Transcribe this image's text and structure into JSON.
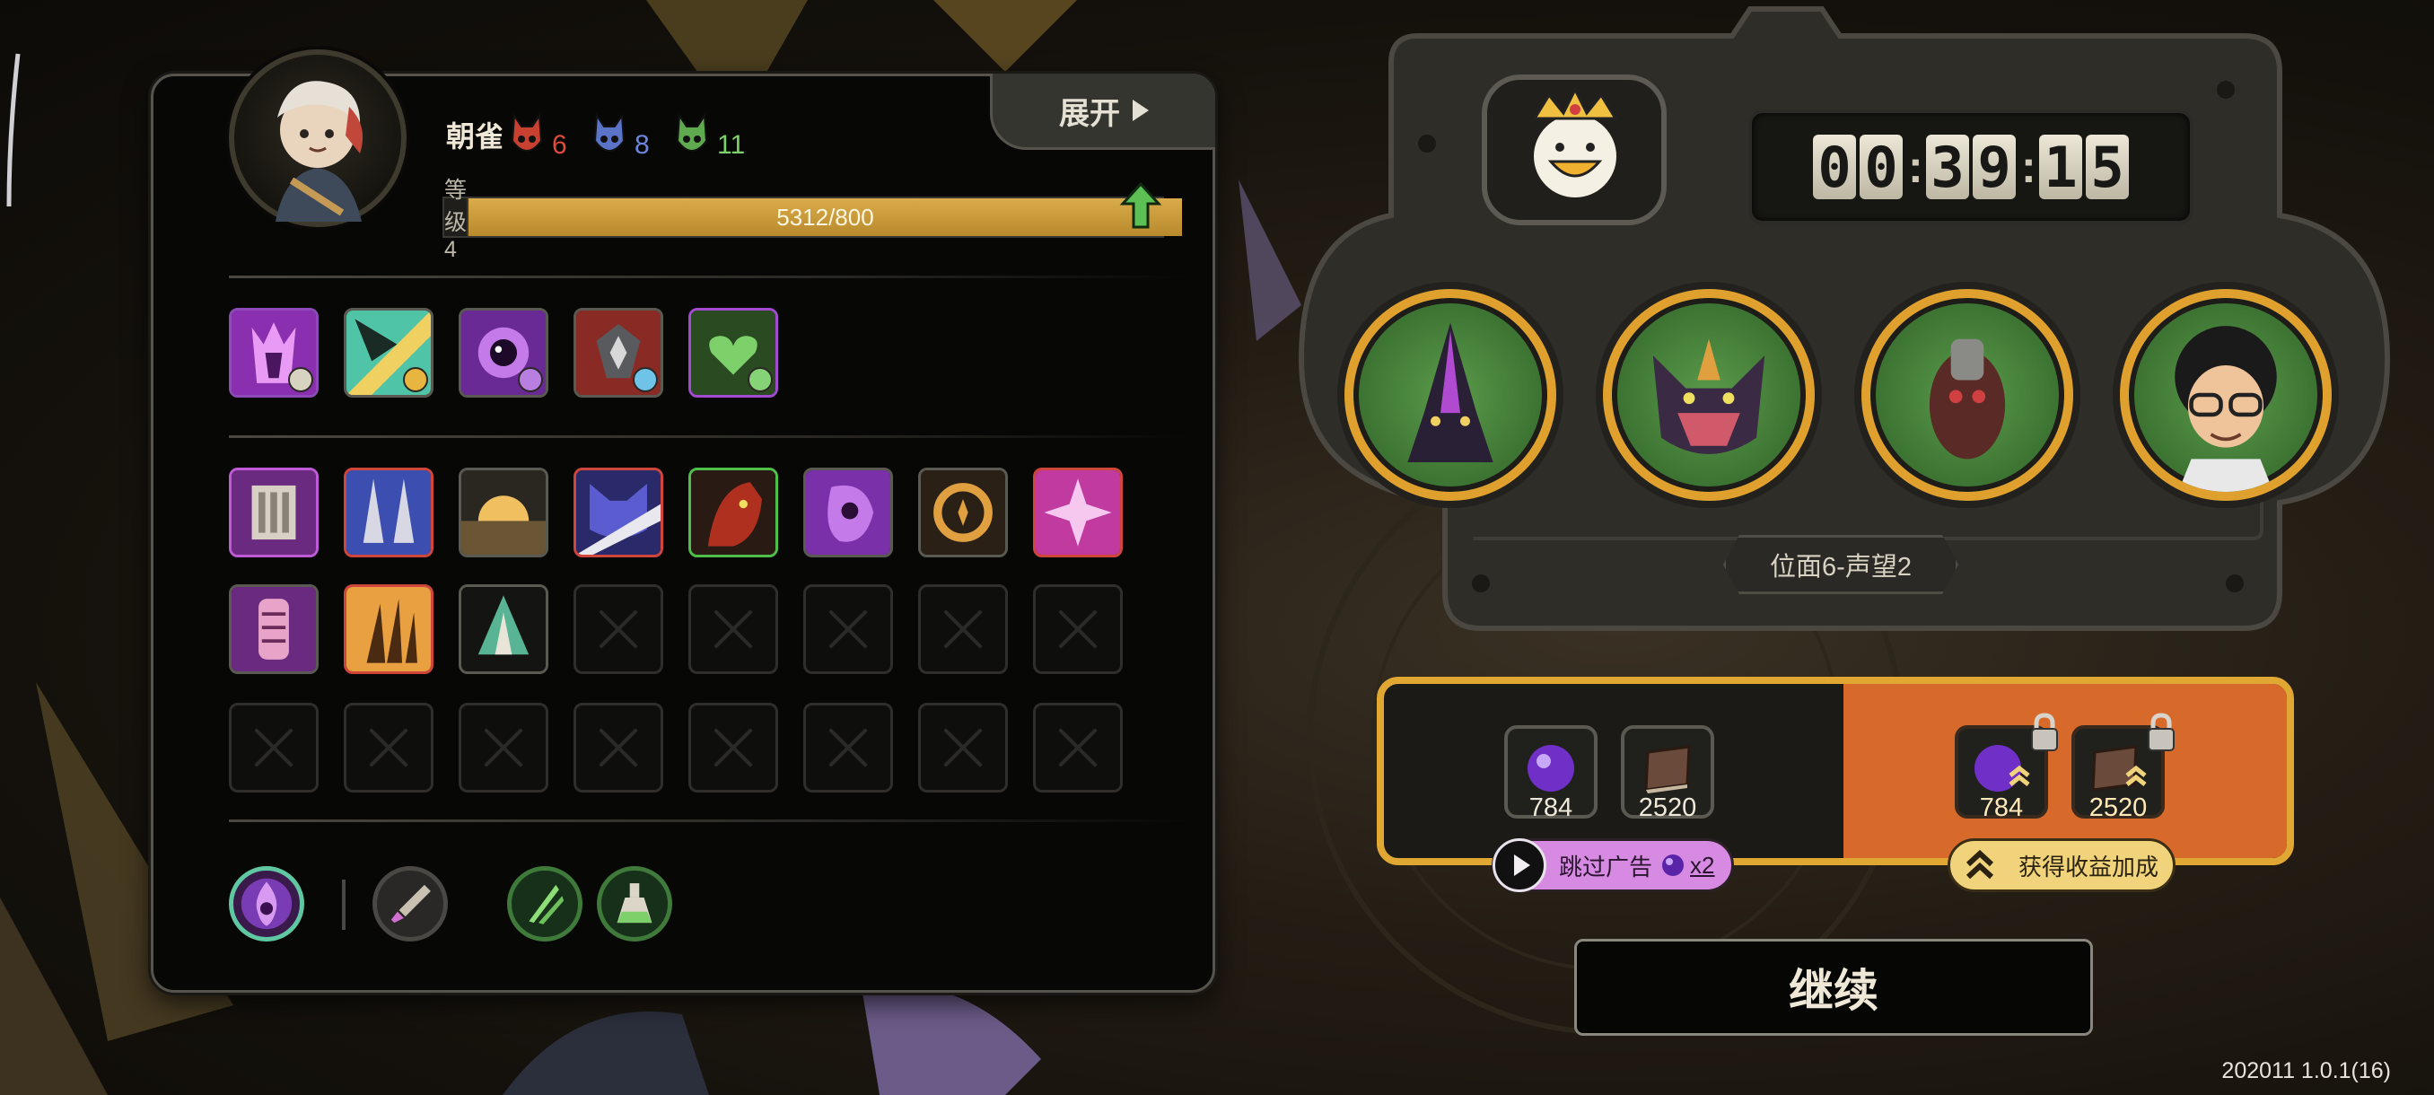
{
  "player": {
    "name": "朝雀",
    "masks": [
      {
        "name": "red-mask",
        "count": "6",
        "color": "#e04a3a"
      },
      {
        "name": "blue-mask",
        "count": "8",
        "color": "#6b86e0"
      },
      {
        "name": "green-mask",
        "count": "11",
        "color": "#7ed06a"
      }
    ],
    "level_label": "等级 4",
    "xp_text": "5312/800",
    "xp_progress": 1.0
  },
  "expand_label": "展开",
  "stage": {
    "timer": [
      "0",
      "0",
      "3",
      "9",
      "1",
      "5"
    ],
    "label": "位面6-声望2"
  },
  "rewards": {
    "base": [
      {
        "icon": "purple-orb-icon",
        "value": "784"
      },
      {
        "icon": "book-icon",
        "value": "2520"
      }
    ],
    "boosted": [
      {
        "icon": "purple-orb-boost-icon",
        "value": "784"
      },
      {
        "icon": "book-boost-icon",
        "value": "2520"
      }
    ],
    "skip_ad_label": "跳过广告",
    "skip_ad_multiplier": "x2",
    "bonus_label": "获得收益加成"
  },
  "continue_label": "继续",
  "version": "202011 1.0.1(16)",
  "colors": {
    "gold": "#e0a733",
    "orange": "#d76a2a",
    "purple": "#a24ad0",
    "green": "#3b7131"
  }
}
